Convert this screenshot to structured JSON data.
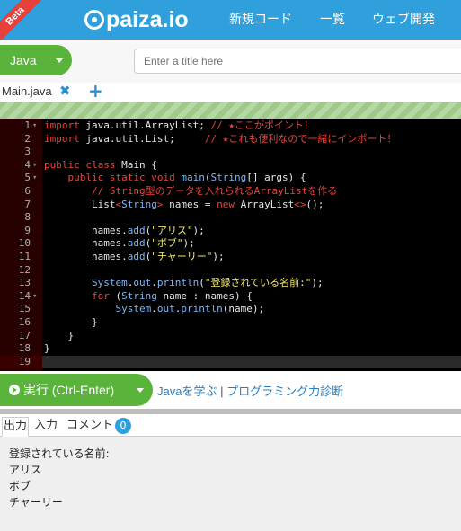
{
  "header": {
    "beta_label": "Beta",
    "logo_text": "paiza.io",
    "nav_new_code": "新規コード",
    "nav_list": "一覧",
    "nav_web": "ウェブ開発",
    "bg_color": "#2fa0dc"
  },
  "toolbar": {
    "language": "Java",
    "title_placeholder": "Enter a title here",
    "title_value": ""
  },
  "file_tabs": {
    "file_name": "Main.java",
    "close_icon": "close-icon",
    "add_icon": "plus-icon"
  },
  "editor": {
    "lines": [
      {
        "num": "1",
        "fold": "▾",
        "tokens": [
          [
            "kw",
            "import"
          ],
          [
            "pl",
            " java.util.ArrayList; "
          ],
          [
            "cm",
            "// ★ここがポイント！"
          ]
        ]
      },
      {
        "num": "2",
        "fold": "",
        "tokens": [
          [
            "kw",
            "import"
          ],
          [
            "pl",
            " java.util.List;     "
          ],
          [
            "cm",
            "// ★これも便利なので一緒にインポート！"
          ]
        ]
      },
      {
        "num": "3",
        "fold": "",
        "tokens": []
      },
      {
        "num": "4",
        "fold": "▾",
        "tokens": [
          [
            "kw",
            "public"
          ],
          [
            "pl",
            " "
          ],
          [
            "kw",
            "class"
          ],
          [
            "pl",
            " Main {"
          ]
        ]
      },
      {
        "num": "5",
        "fold": "▾",
        "tokens": [
          [
            "pl",
            "    "
          ],
          [
            "kw",
            "public"
          ],
          [
            "pl",
            " "
          ],
          [
            "kw",
            "static"
          ],
          [
            "pl",
            " "
          ],
          [
            "kw",
            "void"
          ],
          [
            "pl",
            " "
          ],
          [
            "fn",
            "main"
          ],
          [
            "pl",
            "("
          ],
          [
            "cl",
            "String"
          ],
          [
            "pl",
            "[] args) {"
          ]
        ]
      },
      {
        "num": "6",
        "fold": "",
        "tokens": [
          [
            "pl",
            "        "
          ],
          [
            "cm",
            "// String型のデータを入れられるArrayListを作る"
          ]
        ]
      },
      {
        "num": "7",
        "fold": "",
        "tokens": [
          [
            "pl",
            "        List"
          ],
          [
            "kw",
            "<"
          ],
          [
            "cl",
            "String"
          ],
          [
            "kw",
            ">"
          ],
          [
            "pl",
            " names = "
          ],
          [
            "kw",
            "new"
          ],
          [
            "pl",
            " ArrayList"
          ],
          [
            "kw",
            "<>"
          ],
          [
            "pl",
            "();"
          ]
        ]
      },
      {
        "num": "8",
        "fold": "",
        "tokens": []
      },
      {
        "num": "9",
        "fold": "",
        "tokens": [
          [
            "pl",
            "        names."
          ],
          [
            "fn",
            "add"
          ],
          [
            "pl",
            "("
          ],
          [
            "st",
            "\"アリス\""
          ],
          [
            "pl",
            ");"
          ]
        ]
      },
      {
        "num": "10",
        "fold": "",
        "tokens": [
          [
            "pl",
            "        names."
          ],
          [
            "fn",
            "add"
          ],
          [
            "pl",
            "("
          ],
          [
            "st",
            "\"ボブ\""
          ],
          [
            "pl",
            ");"
          ]
        ]
      },
      {
        "num": "11",
        "fold": "",
        "tokens": [
          [
            "pl",
            "        names."
          ],
          [
            "fn",
            "add"
          ],
          [
            "pl",
            "("
          ],
          [
            "st",
            "\"チャーリー\""
          ],
          [
            "pl",
            ");"
          ]
        ]
      },
      {
        "num": "12",
        "fold": "",
        "tokens": []
      },
      {
        "num": "13",
        "fold": "",
        "tokens": [
          [
            "pl",
            "        "
          ],
          [
            "cl",
            "System"
          ],
          [
            "pl",
            "."
          ],
          [
            "cl",
            "out"
          ],
          [
            "pl",
            "."
          ],
          [
            "fn",
            "println"
          ],
          [
            "pl",
            "("
          ],
          [
            "st",
            "\"登録されている名前:\""
          ],
          [
            "pl",
            ");"
          ]
        ]
      },
      {
        "num": "14",
        "fold": "▾",
        "tokens": [
          [
            "pl",
            "        "
          ],
          [
            "kw",
            "for"
          ],
          [
            "pl",
            " ("
          ],
          [
            "cl",
            "String"
          ],
          [
            "pl",
            " name : names) {"
          ]
        ]
      },
      {
        "num": "15",
        "fold": "",
        "tokens": [
          [
            "pl",
            "            "
          ],
          [
            "cl",
            "System"
          ],
          [
            "pl",
            "."
          ],
          [
            "cl",
            "out"
          ],
          [
            "pl",
            "."
          ],
          [
            "fn",
            "println"
          ],
          [
            "pl",
            "(name);"
          ]
        ]
      },
      {
        "num": "16",
        "fold": "",
        "tokens": [
          [
            "pl",
            "        }"
          ]
        ]
      },
      {
        "num": "17",
        "fold": "",
        "tokens": [
          [
            "pl",
            "    }"
          ]
        ]
      },
      {
        "num": "18",
        "fold": "",
        "tokens": [
          [
            "pl",
            "}"
          ]
        ]
      },
      {
        "num": "19",
        "fold": "",
        "tokens": [],
        "active": true
      }
    ]
  },
  "run": {
    "label": "実行 (Ctrl-Enter)",
    "link_learn": "Javaを学ぶ",
    "separator": " | ",
    "link_diagnose": "プログラミング力診断"
  },
  "output_tabs": {
    "output": "出力",
    "input": "入力",
    "comment": "コメント",
    "comment_count": "0"
  },
  "output": {
    "lines": [
      "登録されている名前:",
      "アリス",
      "ボブ",
      "チャーリー"
    ]
  }
}
